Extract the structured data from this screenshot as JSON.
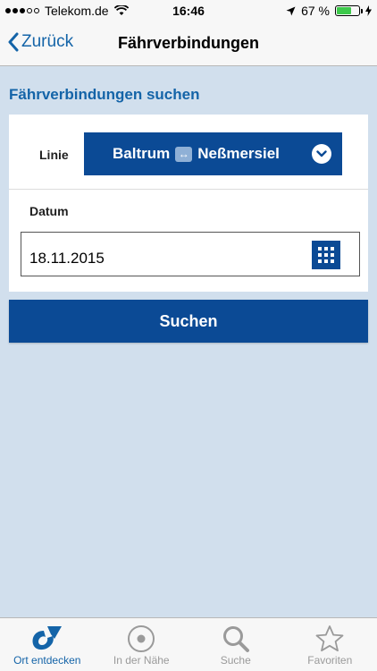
{
  "status_bar": {
    "carrier": "Telekom.de",
    "time": "16:46",
    "battery": "67 %",
    "battery_level": 0.67
  },
  "nav": {
    "back_label": "Zurück",
    "title": "Fährverbindungen"
  },
  "search": {
    "title": "Fährverbindungen suchen",
    "line_label": "Linie",
    "line_from": "Baltrum",
    "line_to": "Neßmersiel",
    "date_label": "Datum",
    "date_value": "18.11.2015",
    "submit_label": "Suchen"
  },
  "tabs": [
    {
      "label": "Ort entdecken",
      "icon": "location-logo-icon",
      "active": true
    },
    {
      "label": "In der Nähe",
      "icon": "nearby-icon",
      "active": false
    },
    {
      "label": "Suche",
      "icon": "search-icon",
      "active": false
    },
    {
      "label": "Favoriten",
      "icon": "star-icon",
      "active": false
    }
  ],
  "colors": {
    "accent": "#1464a8",
    "button": "#0b4a95",
    "background": "#d1dfed"
  }
}
